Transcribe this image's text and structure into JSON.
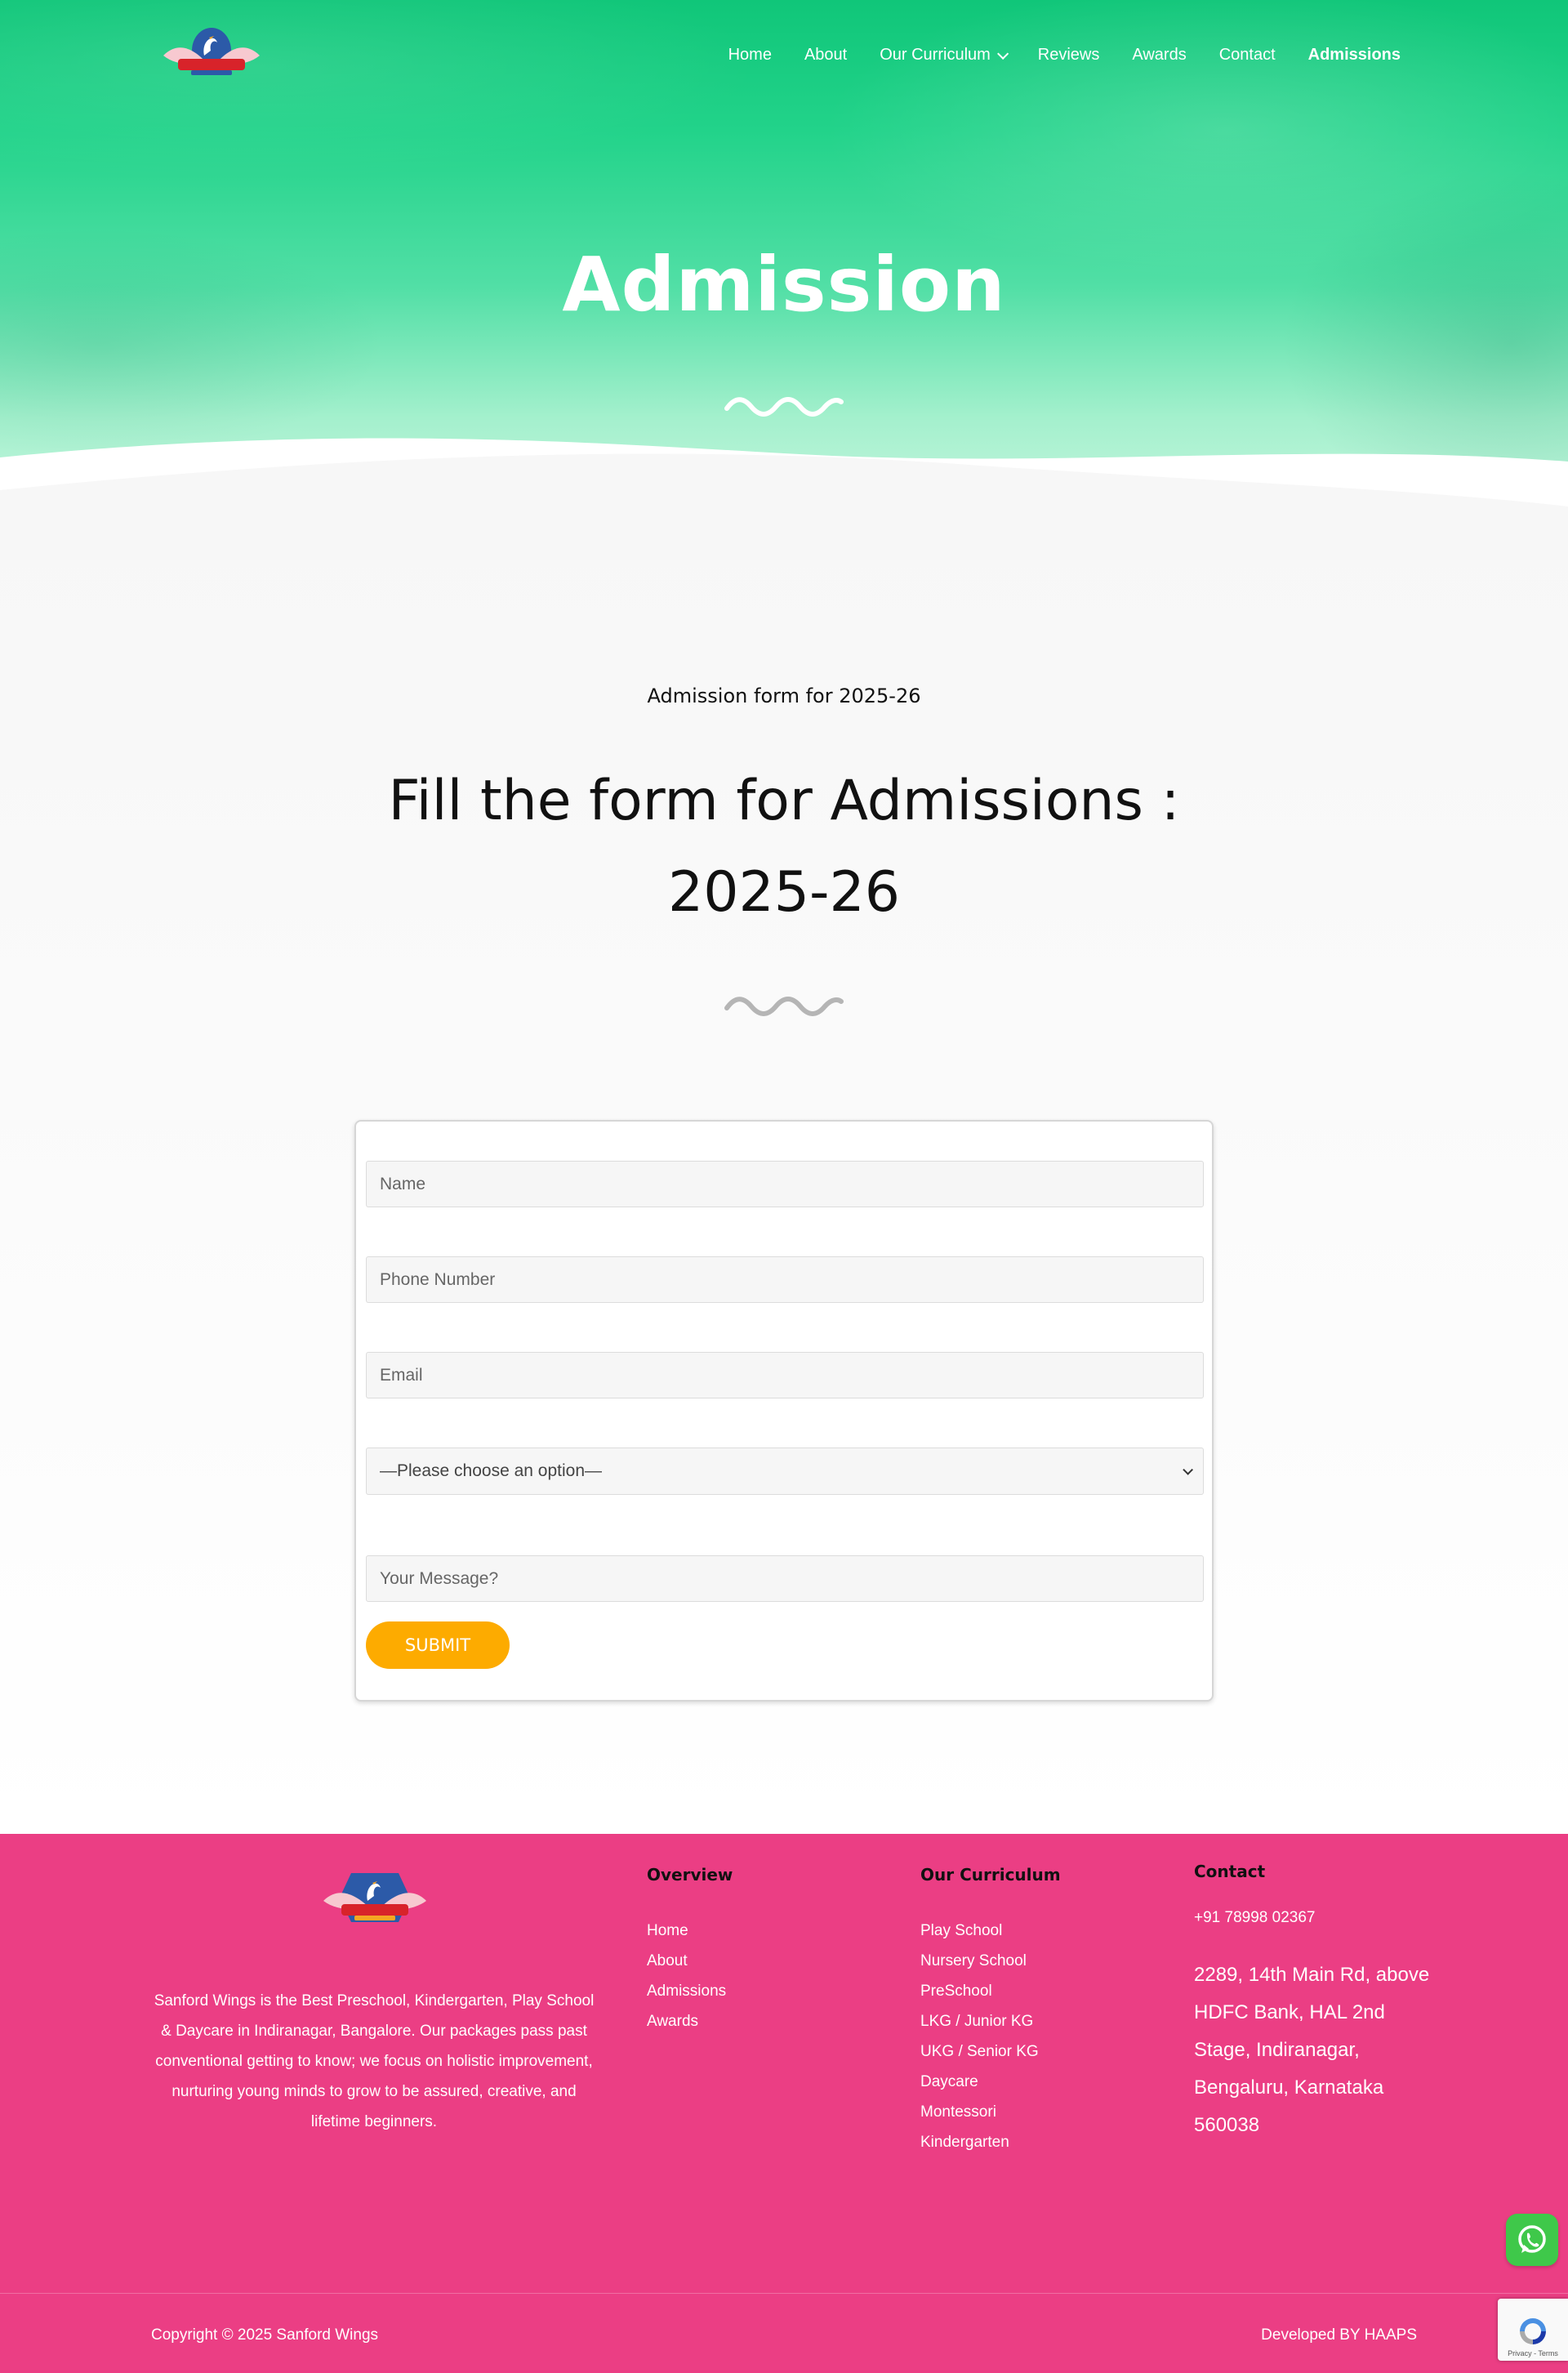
{
  "nav": {
    "items": [
      {
        "label": "Home"
      },
      {
        "label": "About"
      },
      {
        "label": "Our Curriculum"
      },
      {
        "label": "Reviews"
      },
      {
        "label": "Awards"
      },
      {
        "label": "Contact"
      },
      {
        "label": "Admissions"
      }
    ]
  },
  "hero": {
    "title": "Admission"
  },
  "section": {
    "eyebrow": "Admission form for 2025-26",
    "title": "Fill the form for Admissions : 2025-26"
  },
  "form": {
    "name_placeholder": "Name",
    "phone_placeholder": "Phone Number",
    "email_placeholder": "Email",
    "select_value": "—Please choose an option—",
    "message_placeholder": "Your Message?",
    "submit_label": "SUBMIT"
  },
  "footer": {
    "about": "Sanford Wings is the Best Preschool, Kindergarten, Play School & Daycare in Indiranagar, Bangalore. Our packages pass past conventional getting to know; we focus on holistic improvement, nurturing young minds to grow to be assured, creative, and lifetime beginners.",
    "overview": {
      "title": "Overview",
      "links": [
        "Home",
        "About",
        "Admissions",
        "Awards"
      ]
    },
    "curriculum": {
      "title": "Our Curriculum",
      "links": [
        "Play School",
        "Nursery School",
        "PreSchool",
        "LKG / Junior KG",
        "UKG / Senior KG",
        "Daycare",
        "Montessori",
        "Kindergarten"
      ]
    },
    "contact": {
      "title": "Contact",
      "phone": "+91 78998 02367",
      "address": "2289, 14th Main Rd, above HDFC Bank, HAL 2nd Stage, Indiranagar, Bengaluru, Karnataka 560038"
    },
    "copyright": "Copyright © 2025 Sanford Wings",
    "developed": "Developed BY HAAPS"
  },
  "recaptcha": {
    "terms": "Privacy - Terms"
  },
  "colors": {
    "hero_green": "#22d38a",
    "footer_pink": "#eb3e84",
    "submit_orange": "#fdab00",
    "whatsapp_green": "#3fc84a"
  }
}
